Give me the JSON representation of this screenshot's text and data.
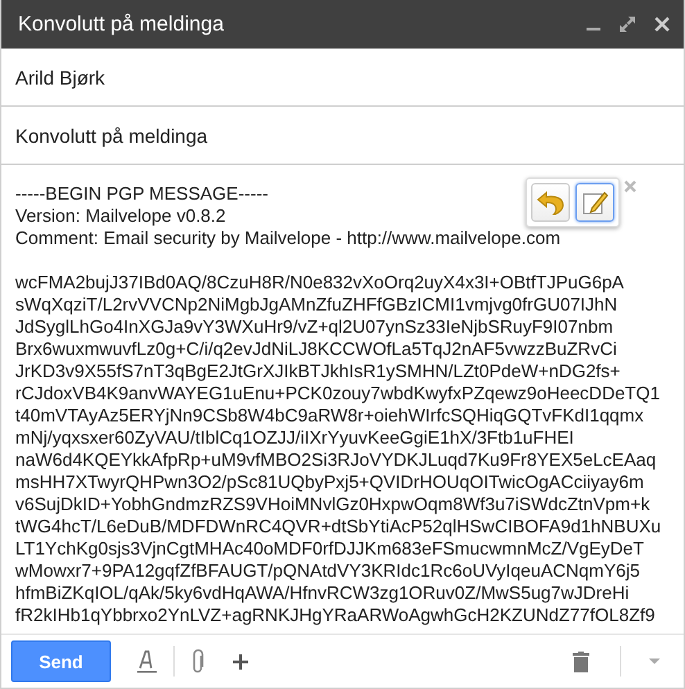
{
  "window": {
    "title": "Konvolutt på meldinga"
  },
  "to": {
    "value": "Arild Bjørk"
  },
  "subject": {
    "value": "Konvolutt på meldinga"
  },
  "body": {
    "header": [
      "-----BEGIN PGP MESSAGE-----",
      "Version: Mailvelope v0.8.2",
      "Comment: Email security by Mailvelope - http://www.mailvelope.com"
    ],
    "lines": [
      "wcFMA2bujJ37IBd0AQ/8CzuH8R/N0e832vXoOrq2uyX4x3I+OBtfTJPuG6pA",
      "sWqXqziT/L2rvVVCNp2NiMgbJgAMnZfuZHFfGBzICMI1vmjvg0frGU07IJhN",
      "JdSyglLhGo4InXGJa9vY3WXuHr9/vZ+ql2U07ynSz33IeNjbSRuyF9I07nbm",
      "Brx6wuxmwuvfLz0g+C/i/q2evJdNiLJ8KCCWOfLa5TqJ2nAF5vwzzBuZRvCi",
      "JrKD3v9X55fS7nT3qBgE2JtGrXJIkBTJkhIsR1ySMHN/LZt0PdeW+nDG2fs+",
      "rCJdoxVB4K9anvWAYEG1uEnu+PCK0zouy7wbdKwyfxPZqewz9oHeecDDeTQ1",
      "t40mVTAyAz5ERYjNn9CSb8W4bC9aRW8r+oiehWIrfcSQHiqGQTvFKdI1qqmx",
      "mNj/yqxsxer60ZyVAU/tIblCq1OZJJ/iIXrYyuvKeeGgiE1hX/3Ftb1uFHEI",
      "naW6d4KQEYkkAfpRp+uM9vfMBO2Si3RJoVYDKJLuqd7Ku9Fr8YEX5eLcEAaq",
      "msHH7XTwyrQHPwn3O2/pSc81UQbyPxj5+QVIDrHOUqOITwicOgACciiyay6m",
      "v6SujDkID+YobhGndmzRZS9VHoiMNvlGz0HxpwOqm8Wf3u7iSWdcZtnVpm+k",
      "tWG4hcT/L6eDuB/MDFDWnRC4QVR+dtSbYtiAcP52qlHSwCIBOFA9d1hNBUXu",
      "LT1YchKg0sjs3VjnCgtMHAc40oMDF0rfDJJKm683eFSmucwmnMcZ/VgEyDeT",
      "wMowxr7+9PA12gqfZfBFAUGT/pQNAtdVY3KRIdc1Rc6oUVyIqeuACNqmY6j5",
      "hfmBiZKqIOL/qAk/5ky6vdHqAWA/HfnvRCW3zg1ORuv0Z/MwS5ug7wJDreHi",
      "fR2kIHb1qYbbrxo2YnLVZ+agRNKJHgYRaARWoAgwhGcH2KZUNdZ77fOL8Zf9"
    ]
  },
  "overlay": {
    "buttons": [
      {
        "kind": "undo",
        "selected": false
      },
      {
        "kind": "edit",
        "selected": true
      }
    ]
  },
  "toolbar": {
    "send": "Send"
  }
}
